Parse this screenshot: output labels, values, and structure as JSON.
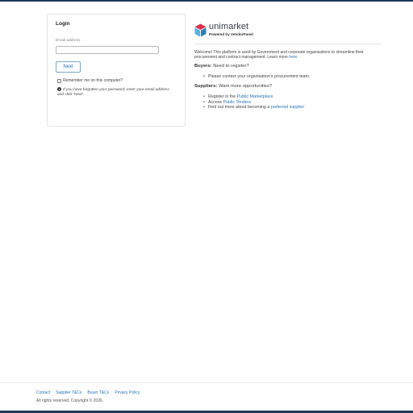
{
  "login": {
    "title": "Login",
    "email_label": "Email address",
    "email_value": "",
    "email_placeholder": "",
    "next_label": "Next",
    "remember_label": "Remember me on this computer?",
    "forgot_hint": "If you have forgotten your password, enter your email address and click 'Next'."
  },
  "brand": {
    "name": "unimarket",
    "powered_by": "Powered by VendorPanel",
    "colors": {
      "top": "#d8324e",
      "left": "#5ab0e0",
      "right": "#2f7fb0",
      "accent": "#1f3a5a"
    }
  },
  "intro": {
    "text": "Welcome! This platform is used by Government and corporate organisations to streamline their procurement and contract management. Learn more",
    "link": "here."
  },
  "buyers": {
    "label": "Buyers:",
    "text": "Need to register?",
    "items": [
      {
        "text": "Please contact your organisation's procurement team."
      }
    ]
  },
  "suppliers": {
    "label": "Suppliers:",
    "text": "Want more opportunities?",
    "items": [
      {
        "text": "Register in the",
        "link": "Public Marketplace"
      },
      {
        "text": "Access",
        "link": "Public Tenders"
      },
      {
        "text": "Find out more about becoming a",
        "link": "preferred supplier"
      }
    ]
  },
  "footer": {
    "links": [
      "Contact",
      "Supplier T&Cs",
      "Buyer T&Cs",
      "Privacy Policy"
    ],
    "copyright": "All rights reserved. Copyright © 2026."
  }
}
